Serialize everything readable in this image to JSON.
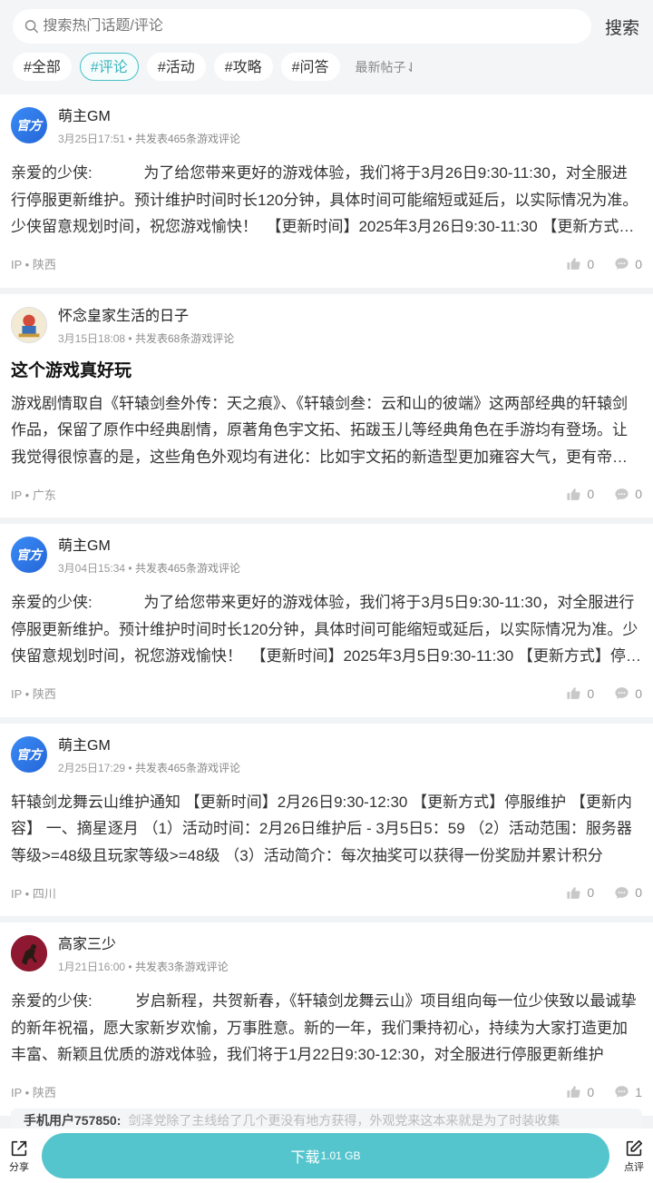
{
  "search": {
    "placeholder": "搜索热门话题/评论",
    "button": "搜索"
  },
  "tags": [
    {
      "label": "#全部",
      "active": false
    },
    {
      "label": "#评论",
      "active": true
    },
    {
      "label": "#活动",
      "active": false
    },
    {
      "label": "#攻略",
      "active": false
    },
    {
      "label": "#问答",
      "active": false
    }
  ],
  "sort_label": "最新帖子⇃",
  "posts": [
    {
      "author": "萌主GM",
      "avatar": "官方",
      "avatar_type": "official",
      "date": "3月25日17:51",
      "count": "共发表465条游戏评论",
      "title": "",
      "body": "亲爱的少侠:            为了给您带来更好的游戏体验，我们将于3月26日9:30-11:30，对全服进行停服更新维护。预计维护时间时长120分钟，具体时间可能缩短或延后，以实际情况为准。少侠留意规划时间，祝您游戏愉快！  【更新时间】2025年3月26日9:30-11:30 【更新方式】停服更新",
      "ip": "IP • 陕西",
      "likes": "0",
      "comments": "0"
    },
    {
      "author": "怀念皇家生活的日子",
      "avatar": "",
      "avatar_type": "pic1",
      "date": "3月15日18:08",
      "count": "共发表68条游戏评论",
      "title": "这个游戏真好玩",
      "body": "游戏剧情取自《轩辕剑叁外传：天之痕》、《轩辕剑叁：云和山的彼端》这两部经典的轩辕剑作品，保留了原作中经典剧情，原著角色宇文拓、拓跋玉儿等经典角色在手游均有登场。让我觉得很惊喜的是，这些角色外观均有进化：比如宇文拓的新造型更加雍容大气，更有帝王之相",
      "ip": "IP • 广东",
      "likes": "0",
      "comments": "0"
    },
    {
      "author": "萌主GM",
      "avatar": "官方",
      "avatar_type": "official",
      "date": "3月04日15:34",
      "count": "共发表465条游戏评论",
      "title": "",
      "body": "亲爱的少侠:            为了给您带来更好的游戏体验，我们将于3月5日9:30-11:30，对全服进行停服更新维护。预计维护时间时长120分钟，具体时间可能缩短或延后，以实际情况为准。少侠留意规划时间，祝您游戏愉快！  【更新时间】2025年3月5日9:30-11:30 【更新方式】停服更新",
      "ip": "IP • 陕西",
      "likes": "0",
      "comments": "0"
    },
    {
      "author": "萌主GM",
      "avatar": "官方",
      "avatar_type": "official",
      "date": "2月25日17:29",
      "count": "共发表465条游戏评论",
      "title": "",
      "body": "轩辕剑龙舞云山维护通知 【更新时间】2月26日9:30-12:30 【更新方式】停服维护 【更新内容】 一、摘星逐月 （1）活动时间：2月26日维护后 - 3月5日5：59 （2）活动范围：服务器等级>=48级且玩家等级>=48级 （3）活动简介：每次抽奖可以获得一份奖励并累计积分",
      "ip": "IP • 四川",
      "likes": "0",
      "comments": "0"
    },
    {
      "author": "高家三少",
      "avatar": "",
      "avatar_type": "pic2",
      "date": "1月21日16:00",
      "count": "共发表3条游戏评论",
      "title": "",
      "body": "亲爱的少侠:          岁启新程，共贺新春，《轩辕剑龙舞云山》项目组向每一位少侠致以最诚挚的新年祝福，愿大家新岁欢愉，万事胜意。新的一年，我们秉持初心，持续为大家打造更加丰富、新颖且优质的游戏体验，我们将于1月22日9:30-12:30，对全服进行停服更新维护",
      "ip": "IP • 陕西",
      "likes": "0",
      "comments": "1"
    }
  ],
  "comment_preview": {
    "user": "手机用户757850:",
    "text": "剑泽党除了主线给了几个更没有地方获得，外观党来这本来就是为了时装收集"
  },
  "bottom": {
    "share": "分享",
    "download": "下载",
    "size": "1.01 GB",
    "review": "点评"
  },
  "colors": {
    "accent": "#55c5cd",
    "tag_active": "#39b4bd",
    "official_avatar": "#2f7ae5"
  }
}
